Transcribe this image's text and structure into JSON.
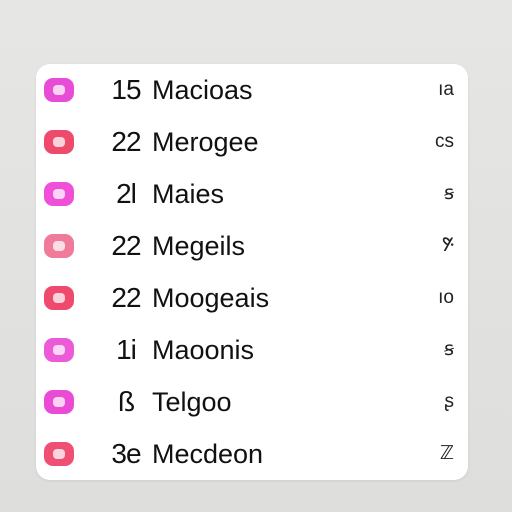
{
  "colors": {
    "background": "#e3e3e1",
    "card": "#ffffff",
    "text": "#111111"
  },
  "list": {
    "items": [
      {
        "icon": "pink-app-icon",
        "icon_color": "#e84bd6",
        "number": "15",
        "name": "Macioas",
        "value": "ıa"
      },
      {
        "icon": "red-app-icon",
        "icon_color": "#ee4a6c",
        "number": "22",
        "name": "Merogee",
        "value": "cs"
      },
      {
        "icon": "magenta-app-icon",
        "icon_color": "#f04fd8",
        "number": "2l",
        "name": "Maies",
        "value": "ꞩ"
      },
      {
        "icon": "gradient-app-icon",
        "icon_color": "#f07a9a",
        "number": "22",
        "name": "Megeils",
        "value": "ꚣ"
      },
      {
        "icon": "red-app-icon",
        "icon_color": "#ef4a6e",
        "number": "22",
        "name": "Moogeais",
        "value": "ıo"
      },
      {
        "icon": "pink-app-icon",
        "icon_color": "#ec5ad8",
        "number": "1i",
        "name": "Maoonis",
        "value": "ꞩ"
      },
      {
        "icon": "magenta-app-icon",
        "icon_color": "#ea4bd4",
        "number": "ß",
        "name": "Telgoo",
        "value": "ʂ"
      },
      {
        "icon": "red-app-icon",
        "icon_color": "#ef4f73",
        "number": "3e",
        "name": "Mecdeon",
        "value": "ℤ"
      }
    ]
  }
}
